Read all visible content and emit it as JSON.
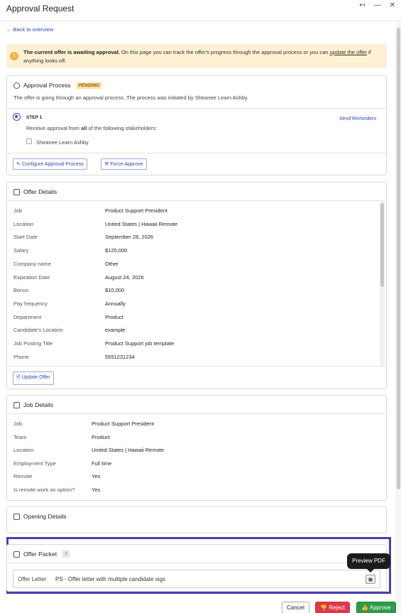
{
  "window": {
    "title": "Approval Request"
  },
  "nav": {
    "back_label": "← Back to overview"
  },
  "header_icons": [
    {
      "name": "collapse-icon",
      "glyph": "↤"
    },
    {
      "name": "minimize-icon",
      "glyph": "—"
    },
    {
      "name": "close-icon",
      "glyph": "✕"
    }
  ],
  "alert": {
    "bold_text": "The current offer is awaiting approval.",
    "text": " On this page you can track the offer's progress through the approval process or you can ",
    "link_text": "update the offer",
    "tail_text": " if anything looks off."
  },
  "approval": {
    "title": "Approval Process",
    "status": "PENDING",
    "description": "The offer is going through an approval process. The process was initiated by Sheanee Learn Ashby.",
    "step_label": "STEP 1",
    "step_text_pre": "Receive approval from ",
    "step_text_bold": "all",
    "step_text_post": " of the following stakeholders:",
    "send_reminders": "Send Reminders",
    "stakeholder": "Sheanee Learn Ashby",
    "configure_button": "Configure Approval Process",
    "force_button": "Force-Approve"
  },
  "offer_details": {
    "title": "Offer Details",
    "rows": [
      {
        "label": "Job",
        "value": "Product Support President"
      },
      {
        "label": "Location",
        "value": "United States | Hawaii Remote"
      },
      {
        "label": "Start Date",
        "value": "September 28, 2026"
      },
      {
        "label": "Salary",
        "value": "$125,000"
      },
      {
        "label": "Company name",
        "value": "Other"
      },
      {
        "label": "Expiration Date",
        "value": "August 24, 2026"
      },
      {
        "label": "Bonus",
        "value": "$10,000"
      },
      {
        "label": "Pay frequency",
        "value": "Annually"
      },
      {
        "label": "Department",
        "value": "Product"
      },
      {
        "label": "Candidate's Location",
        "value": "example"
      },
      {
        "label": "Job Posting Title",
        "value": "Product Support job template"
      },
      {
        "label": "Phone",
        "value": "5551231234"
      }
    ],
    "update_button": "Update Offer"
  },
  "job_details": {
    "title": "Job Details",
    "rows": [
      {
        "label": "Job",
        "value": "Product Support President"
      },
      {
        "label": "Team",
        "value": "Product"
      },
      {
        "label": "Location",
        "value": "United States | Hawaii Remote"
      },
      {
        "label": "Employment Type",
        "value": "Full time"
      },
      {
        "label": "Remote",
        "value": "Yes"
      },
      {
        "label": "Is remote work an option?",
        "value": "Yes"
      }
    ]
  },
  "opening_details": {
    "title": "Opening Details"
  },
  "offer_packet": {
    "title": "Offer Packet",
    "info_glyph": "i",
    "field_label": "Offer Letter",
    "field_value": "PS - Offer letter with multiple candidate sigs",
    "tooltip": "Preview PDF"
  },
  "footer": {
    "cancel": "Cancel",
    "reject": "Reject",
    "approve": "Approve"
  },
  "colors": {
    "accent": "#2f47b7",
    "pending_bg": "#f9e0a3",
    "reject": "#dd3a49",
    "approve": "#2c9b4b",
    "highlight": "#4a3fb0"
  }
}
